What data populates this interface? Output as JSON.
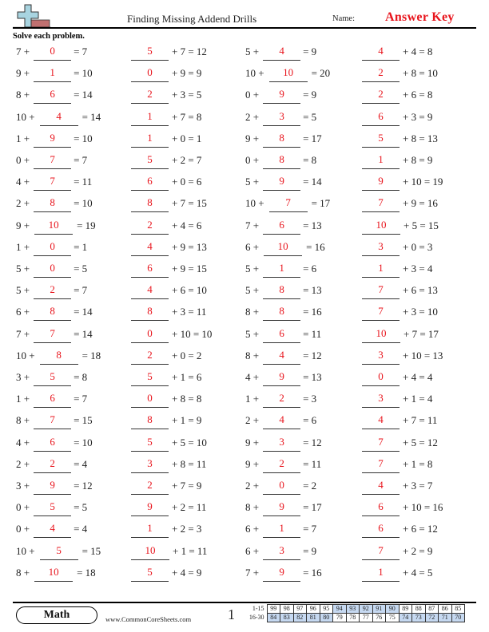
{
  "header": {
    "title": "Finding Missing Addend Drills",
    "name_label": "Name:",
    "name_value": "Answer Key",
    "logo": "plus-sign-logo-icon"
  },
  "instructions": "Solve each problem.",
  "colors": {
    "answer": "#e8141c",
    "score_shade": "#c6d9f1"
  },
  "problems": [
    [
      {
        "pre": "7 +",
        "ans": "0",
        "post": "= 7"
      },
      {
        "pre": "",
        "ans": "5",
        "post": "+ 7 = 12"
      },
      {
        "pre": "5 +",
        "ans": "4",
        "post": "= 9"
      },
      {
        "pre": "",
        "ans": "4",
        "post": "+ 4 = 8"
      }
    ],
    [
      {
        "pre": "9 +",
        "ans": "1",
        "post": "= 10"
      },
      {
        "pre": "",
        "ans": "0",
        "post": "+ 9 = 9"
      },
      {
        "pre": "10 +",
        "ans": "10",
        "post": "= 20"
      },
      {
        "pre": "",
        "ans": "2",
        "post": "+ 8 = 10"
      }
    ],
    [
      {
        "pre": "8 +",
        "ans": "6",
        "post": "= 14"
      },
      {
        "pre": "",
        "ans": "2",
        "post": "+ 3 = 5"
      },
      {
        "pre": "0 +",
        "ans": "9",
        "post": "= 9"
      },
      {
        "pre": "",
        "ans": "2",
        "post": "+ 6 = 8"
      }
    ],
    [
      {
        "pre": "10 +",
        "ans": "4",
        "post": "= 14"
      },
      {
        "pre": "",
        "ans": "1",
        "post": "+ 7 = 8"
      },
      {
        "pre": "2 +",
        "ans": "3",
        "post": "= 5"
      },
      {
        "pre": "",
        "ans": "6",
        "post": "+ 3 = 9"
      }
    ],
    [
      {
        "pre": "1 +",
        "ans": "9",
        "post": "= 10"
      },
      {
        "pre": "",
        "ans": "1",
        "post": "+ 0 = 1"
      },
      {
        "pre": "9 +",
        "ans": "8",
        "post": "= 17"
      },
      {
        "pre": "",
        "ans": "5",
        "post": "+ 8 = 13"
      }
    ],
    [
      {
        "pre": "0 +",
        "ans": "7",
        "post": "= 7"
      },
      {
        "pre": "",
        "ans": "5",
        "post": "+ 2 = 7"
      },
      {
        "pre": "0 +",
        "ans": "8",
        "post": "= 8"
      },
      {
        "pre": "",
        "ans": "1",
        "post": "+ 8 = 9"
      }
    ],
    [
      {
        "pre": "4 +",
        "ans": "7",
        "post": "= 11"
      },
      {
        "pre": "",
        "ans": "6",
        "post": "+ 0 = 6"
      },
      {
        "pre": "5 +",
        "ans": "9",
        "post": "= 14"
      },
      {
        "pre": "",
        "ans": "9",
        "post": "+ 10 = 19"
      }
    ],
    [
      {
        "pre": "2 +",
        "ans": "8",
        "post": "= 10"
      },
      {
        "pre": "",
        "ans": "8",
        "post": "+ 7 = 15"
      },
      {
        "pre": "10 +",
        "ans": "7",
        "post": "= 17"
      },
      {
        "pre": "",
        "ans": "7",
        "post": "+ 9 = 16"
      }
    ],
    [
      {
        "pre": "9 +",
        "ans": "10",
        "post": "= 19"
      },
      {
        "pre": "",
        "ans": "2",
        "post": "+ 4 = 6"
      },
      {
        "pre": "7 +",
        "ans": "6",
        "post": "= 13"
      },
      {
        "pre": "",
        "ans": "10",
        "post": "+ 5 = 15"
      }
    ],
    [
      {
        "pre": "1 +",
        "ans": "0",
        "post": "= 1"
      },
      {
        "pre": "",
        "ans": "4",
        "post": "+ 9 = 13"
      },
      {
        "pre": "6 +",
        "ans": "10",
        "post": "= 16"
      },
      {
        "pre": "",
        "ans": "3",
        "post": "+ 0 = 3"
      }
    ],
    [
      {
        "pre": "5 +",
        "ans": "0",
        "post": "= 5"
      },
      {
        "pre": "",
        "ans": "6",
        "post": "+ 9 = 15"
      },
      {
        "pre": "5 +",
        "ans": "1",
        "post": "= 6"
      },
      {
        "pre": "",
        "ans": "1",
        "post": "+ 3 = 4"
      }
    ],
    [
      {
        "pre": "5 +",
        "ans": "2",
        "post": "= 7"
      },
      {
        "pre": "",
        "ans": "4",
        "post": "+ 6 = 10"
      },
      {
        "pre": "5 +",
        "ans": "8",
        "post": "= 13"
      },
      {
        "pre": "",
        "ans": "7",
        "post": "+ 6 = 13"
      }
    ],
    [
      {
        "pre": "6 +",
        "ans": "8",
        "post": "= 14"
      },
      {
        "pre": "",
        "ans": "8",
        "post": "+ 3 = 11"
      },
      {
        "pre": "8 +",
        "ans": "8",
        "post": "= 16"
      },
      {
        "pre": "",
        "ans": "7",
        "post": "+ 3 = 10"
      }
    ],
    [
      {
        "pre": "7 +",
        "ans": "7",
        "post": "= 14"
      },
      {
        "pre": "",
        "ans": "0",
        "post": "+ 10 = 10"
      },
      {
        "pre": "5 +",
        "ans": "6",
        "post": "= 11"
      },
      {
        "pre": "",
        "ans": "10",
        "post": "+ 7 = 17"
      }
    ],
    [
      {
        "pre": "10 +",
        "ans": "8",
        "post": "= 18"
      },
      {
        "pre": "",
        "ans": "2",
        "post": "+ 0 = 2"
      },
      {
        "pre": "8 +",
        "ans": "4",
        "post": "= 12"
      },
      {
        "pre": "",
        "ans": "3",
        "post": "+ 10 = 13"
      }
    ],
    [
      {
        "pre": "3 +",
        "ans": "5",
        "post": "= 8"
      },
      {
        "pre": "",
        "ans": "5",
        "post": "+ 1 = 6"
      },
      {
        "pre": "4 +",
        "ans": "9",
        "post": "= 13"
      },
      {
        "pre": "",
        "ans": "0",
        "post": "+ 4 = 4"
      }
    ],
    [
      {
        "pre": "1 +",
        "ans": "6",
        "post": "= 7"
      },
      {
        "pre": "",
        "ans": "0",
        "post": "+ 8 = 8"
      },
      {
        "pre": "1 +",
        "ans": "2",
        "post": "= 3"
      },
      {
        "pre": "",
        "ans": "3",
        "post": "+ 1 = 4"
      }
    ],
    [
      {
        "pre": "8 +",
        "ans": "7",
        "post": "= 15"
      },
      {
        "pre": "",
        "ans": "8",
        "post": "+ 1 = 9"
      },
      {
        "pre": "2 +",
        "ans": "4",
        "post": "= 6"
      },
      {
        "pre": "",
        "ans": "4",
        "post": "+ 7 = 11"
      }
    ],
    [
      {
        "pre": "4 +",
        "ans": "6",
        "post": "= 10"
      },
      {
        "pre": "",
        "ans": "5",
        "post": "+ 5 = 10"
      },
      {
        "pre": "9 +",
        "ans": "3",
        "post": "= 12"
      },
      {
        "pre": "",
        "ans": "7",
        "post": "+ 5 = 12"
      }
    ],
    [
      {
        "pre": "2 +",
        "ans": "2",
        "post": "= 4"
      },
      {
        "pre": "",
        "ans": "3",
        "post": "+ 8 = 11"
      },
      {
        "pre": "9 +",
        "ans": "2",
        "post": "= 11"
      },
      {
        "pre": "",
        "ans": "7",
        "post": "+ 1 = 8"
      }
    ],
    [
      {
        "pre": "3 +",
        "ans": "9",
        "post": "= 12"
      },
      {
        "pre": "",
        "ans": "2",
        "post": "+ 7 = 9"
      },
      {
        "pre": "2 +",
        "ans": "0",
        "post": "= 2"
      },
      {
        "pre": "",
        "ans": "4",
        "post": "+ 3 = 7"
      }
    ],
    [
      {
        "pre": "0 +",
        "ans": "5",
        "post": "= 5"
      },
      {
        "pre": "",
        "ans": "9",
        "post": "+ 2 = 11"
      },
      {
        "pre": "8 +",
        "ans": "9",
        "post": "= 17"
      },
      {
        "pre": "",
        "ans": "6",
        "post": "+ 10 = 16"
      }
    ],
    [
      {
        "pre": "0 +",
        "ans": "4",
        "post": "= 4"
      },
      {
        "pre": "",
        "ans": "1",
        "post": "+ 2 = 3"
      },
      {
        "pre": "6 +",
        "ans": "1",
        "post": "= 7"
      },
      {
        "pre": "",
        "ans": "6",
        "post": "+ 6 = 12"
      }
    ],
    [
      {
        "pre": "10 +",
        "ans": "5",
        "post": "= 15"
      },
      {
        "pre": "",
        "ans": "10",
        "post": "+ 1 = 11"
      },
      {
        "pre": "6 +",
        "ans": "3",
        "post": "= 9"
      },
      {
        "pre": "",
        "ans": "7",
        "post": "+ 2 = 9"
      }
    ],
    [
      {
        "pre": "8 +",
        "ans": "10",
        "post": "= 18"
      },
      {
        "pre": "",
        "ans": "5",
        "post": "+ 4 = 9"
      },
      {
        "pre": "7 +",
        "ans": "9",
        "post": "= 16"
      },
      {
        "pre": "",
        "ans": "1",
        "post": "+ 4 = 5"
      }
    ]
  ],
  "footer": {
    "subject": "Math",
    "website": "www.CommonCoreSheets.com",
    "page_number": "1",
    "score_table": [
      {
        "range": "1-15",
        "scores": [
          "99",
          "98",
          "97",
          "96",
          "95",
          "94",
          "93",
          "92",
          "91",
          "90",
          "89",
          "88",
          "87",
          "86",
          "85"
        ],
        "shaded": [
          false,
          false,
          false,
          false,
          false,
          true,
          true,
          true,
          true,
          true,
          false,
          false,
          false,
          false,
          false
        ]
      },
      {
        "range": "16-30",
        "scores": [
          "84",
          "83",
          "82",
          "81",
          "80",
          "79",
          "78",
          "77",
          "76",
          "75",
          "74",
          "73",
          "72",
          "71",
          "70"
        ],
        "shaded": [
          true,
          true,
          true,
          true,
          true,
          false,
          false,
          false,
          false,
          false,
          true,
          true,
          true,
          true,
          true
        ]
      }
    ]
  }
}
